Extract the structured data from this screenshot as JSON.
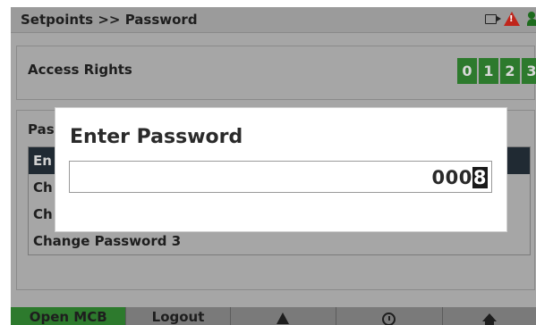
{
  "header": {
    "breadcrumb": "Setpoints >> Password",
    "icons": [
      "camera-icon",
      "warning-icon",
      "user-icon"
    ],
    "warning_glyph": "!"
  },
  "access": {
    "label": "Access Rights",
    "levels": [
      "0",
      "1",
      "2",
      "3"
    ],
    "level_color": "#2d7a2d"
  },
  "password_panel": {
    "heading": "Pas",
    "items": [
      "En",
      "Ch",
      "Ch",
      "Change Password 3"
    ],
    "selected_index": 0
  },
  "dialog": {
    "title": "Enter Password",
    "value_prefix": "000",
    "value_cursor": "8"
  },
  "bottom_bar": {
    "open_mcb": "Open MCB",
    "logout": "Logout",
    "icons": [
      "alarm-icon",
      "history-icon",
      "home-icon"
    ]
  },
  "colors": {
    "accent_green": "#2d7a2d",
    "warning_red": "#c0251b",
    "selected_row": "#202a33"
  }
}
